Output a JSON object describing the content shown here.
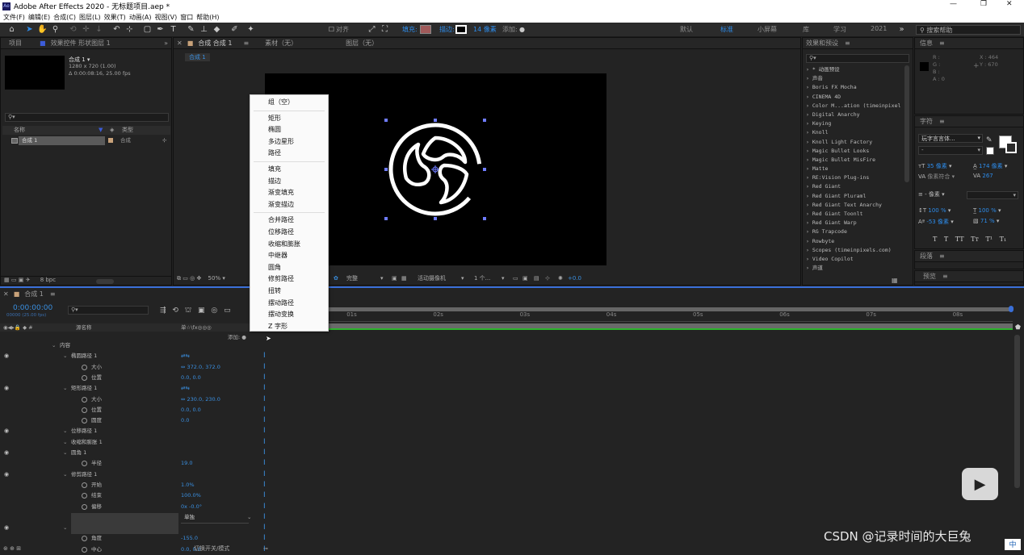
{
  "app": {
    "title": "Adobe After Effects 2020 - 无标题项目.aep *",
    "logo": "Ae"
  },
  "window_controls": {
    "min": "—",
    "max": "❐",
    "close": "✕"
  },
  "menu": [
    "文件(F)",
    "编辑(E)",
    "合成(C)",
    "图层(L)",
    "效果(T)",
    "动画(A)",
    "视图(V)",
    "窗口",
    "帮助(H)"
  ],
  "toolbar": {
    "align_label": "对齐",
    "fill_label": "填充:",
    "stroke_label": "描边:",
    "stroke_width": "14 像素",
    "add_label": "添加:",
    "fill_color": "#a05a5a"
  },
  "workspaces": [
    "默认",
    "标准",
    "小屏幕",
    "库",
    "学习",
    "2021"
  ],
  "active_workspace": "标准",
  "search_help": {
    "placeholder": "搜索帮助"
  },
  "project_panel": {
    "tab": "项目",
    "effects_tab": "效果控件 形状图层 1",
    "comp_name": "合成 1 ▾",
    "comp_size": "1280 x 720 (1.00)",
    "comp_duration": "Δ 0:00:08:16, 25.00 fps",
    "col_name": "名称",
    "col_type": "类型",
    "item_name": "合成 1",
    "item_type": "合成",
    "bpc": "8 bpc"
  },
  "composition_panel": {
    "tab": "合成 合成 1",
    "material_tab": "素材（无）",
    "layer_tab": "图层（无）",
    "breadcrumb": "合成 1",
    "zoom": "50%",
    "quality": "完整",
    "camera": "活动摄像机",
    "views": "1 个...",
    "exposure": "+0.0"
  },
  "effects_panel": {
    "title": "效果和预设",
    "items": [
      "* 动画预设",
      "声音",
      "Boris FX Mocha",
      "CINEMA 4D",
      "Color M...ation (timeinpixel",
      "Digital Anarchy",
      "Keying",
      "Knoll",
      "Knoll Light Factory",
      "Magic Bullet Looks",
      "Magic Bullet MisFire",
      "Matte",
      "RE:Vision Plug-ins",
      "Red Giant",
      "Red Giant Pluraml",
      "Red Giant Text Anarchy",
      "Red Giant Toonlt",
      "Red Giant Warp",
      "RG Trapcode",
      "Rowbyte",
      "Scopes (timeinpixels.com)",
      "Video Copilot",
      "声道"
    ]
  },
  "info_panel": {
    "title": "信息",
    "r": "R :",
    "g": "G :",
    "b": "B :",
    "a": "A : 0",
    "x": "X : 464",
    "y": "Y : 670"
  },
  "character_panel": {
    "title": "字符",
    "font": "玩字言言体...",
    "size": "35 像素",
    "leading": "174 像素",
    "kerning": "像素符合 ▾",
    "tracking": "267",
    "indent": "- 像素",
    "vscale": "100 %",
    "hscale": "100 %",
    "baseline": "-53 像素",
    "tsume": "71 %",
    "styles": [
      "T",
      "T",
      "TT",
      "Tт",
      "T¹",
      "T₁"
    ]
  },
  "paragraph_panel": {
    "title": "段落"
  },
  "preview_panel": {
    "title": "预览"
  },
  "context_menu": {
    "groups": [
      [
        "组（空）"
      ],
      [
        "矩形",
        "椭圆",
        "多边星形",
        "路径"
      ],
      [
        "填充",
        "描边",
        "渐变填充",
        "渐变描边"
      ],
      [
        "合并路径",
        "位移路径",
        "收缩和膨胀",
        "中继器",
        "圆角",
        "修剪路径",
        "扭转",
        "摆动路径",
        "摆动变换",
        "Z 字形"
      ]
    ]
  },
  "timeline": {
    "tab": "合成 1",
    "timecode": "0:00:00:00",
    "fps_label": "00000 (25.00 fps)",
    "col_name": "源名称",
    "col_switches": "单☆\\fx◎◎◎",
    "add_label": "添加: ●",
    "toggle_label": "切换开关/模式",
    "ruler": [
      "0s",
      "01s",
      "02s",
      "03s",
      "04s",
      "05s",
      "06s",
      "07s",
      "08s"
    ],
    "rows": [
      {
        "indent": 64,
        "label": "内容",
        "val": "",
        "eye": false,
        "stop": false
      },
      {
        "indent": 78,
        "label": "椭圆路径 1",
        "val": "⇄⇆",
        "eye": true,
        "stop": false
      },
      {
        "indent": 100,
        "label": "大小",
        "val": "⇔ 372.0, 372.0",
        "eye": false,
        "stop": true
      },
      {
        "indent": 100,
        "label": "位置",
        "val": "0.0, 0.0",
        "eye": false,
        "stop": true
      },
      {
        "indent": 78,
        "label": "矩形路径 1",
        "val": "⇄⇆",
        "eye": true,
        "stop": false
      },
      {
        "indent": 100,
        "label": "大小",
        "val": "⇔ 230.0, 230.0",
        "eye": false,
        "stop": true
      },
      {
        "indent": 100,
        "label": "位置",
        "val": "0.0, 0.0",
        "eye": false,
        "stop": true
      },
      {
        "indent": 100,
        "label": "圆度",
        "val": "0.0",
        "eye": false,
        "stop": true
      },
      {
        "indent": 78,
        "label": "位移路径 1",
        "val": "",
        "eye": true,
        "stop": false
      },
      {
        "indent": 78,
        "label": "收缩和膨胀 1",
        "val": "",
        "eye": false,
        "stop": false
      },
      {
        "indent": 78,
        "label": "圆角 1",
        "val": "",
        "eye": true,
        "stop": false
      },
      {
        "indent": 100,
        "label": "半径",
        "val": "19.0",
        "eye": false,
        "stop": true
      },
      {
        "indent": 78,
        "label": "修剪路径 1",
        "val": "",
        "eye": true,
        "stop": false
      },
      {
        "indent": 100,
        "label": "开始",
        "val": "1.0%",
        "eye": false,
        "stop": true
      },
      {
        "indent": 100,
        "label": "结束",
        "val": "100.0%",
        "eye": false,
        "stop": true
      },
      {
        "indent": 100,
        "label": "偏移",
        "val": "0x -0.0°",
        "eye": false,
        "stop": true
      },
      {
        "indent": 100,
        "label": "修剪多重形状",
        "val": "单独",
        "eye": false,
        "stop": false
      },
      {
        "indent": 78,
        "label": "扭转 1",
        "val": "",
        "eye": true,
        "stop": false
      },
      {
        "indent": 100,
        "label": "角度",
        "val": "-155.0",
        "eye": false,
        "stop": true
      },
      {
        "indent": 100,
        "label": "中心",
        "val": "0.0, 0.0",
        "eye": false,
        "stop": true
      }
    ]
  },
  "watermark": "CSDN @记录时间的大巨兔"
}
